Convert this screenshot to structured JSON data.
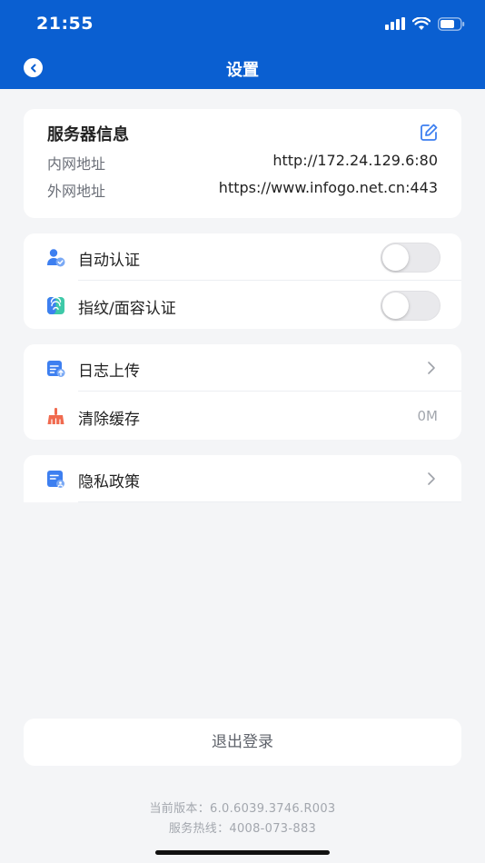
{
  "status_bar": {
    "time": "21:55"
  },
  "nav": {
    "title": "设置"
  },
  "server_info": {
    "title": "服务器信息",
    "intranet_label": "内网地址",
    "intranet_value": "http://172.24.129.6:80",
    "extranet_label": "外网地址",
    "extranet_value": "https://www.infogo.net.cn:443"
  },
  "auth": {
    "auto_auth_label": "自动认证",
    "auto_auth_enabled": false,
    "biometric_label": "指纹/面容认证",
    "biometric_enabled": false
  },
  "tools": {
    "log_upload_label": "日志上传",
    "clear_cache_label": "清除缓存",
    "cache_size": "0M"
  },
  "privacy": {
    "label": "隐私政策"
  },
  "logout": {
    "label": "退出登录"
  },
  "footer": {
    "version": "当前版本：6.0.6039.3746.R003",
    "hotline": "服务热线：4008-073-883"
  },
  "colors": {
    "header_blue": "#0a5fd1",
    "icon_blue": "#3d7ff0",
    "icon_red": "#f06a4f",
    "icon_green": "#3ec9a8"
  }
}
